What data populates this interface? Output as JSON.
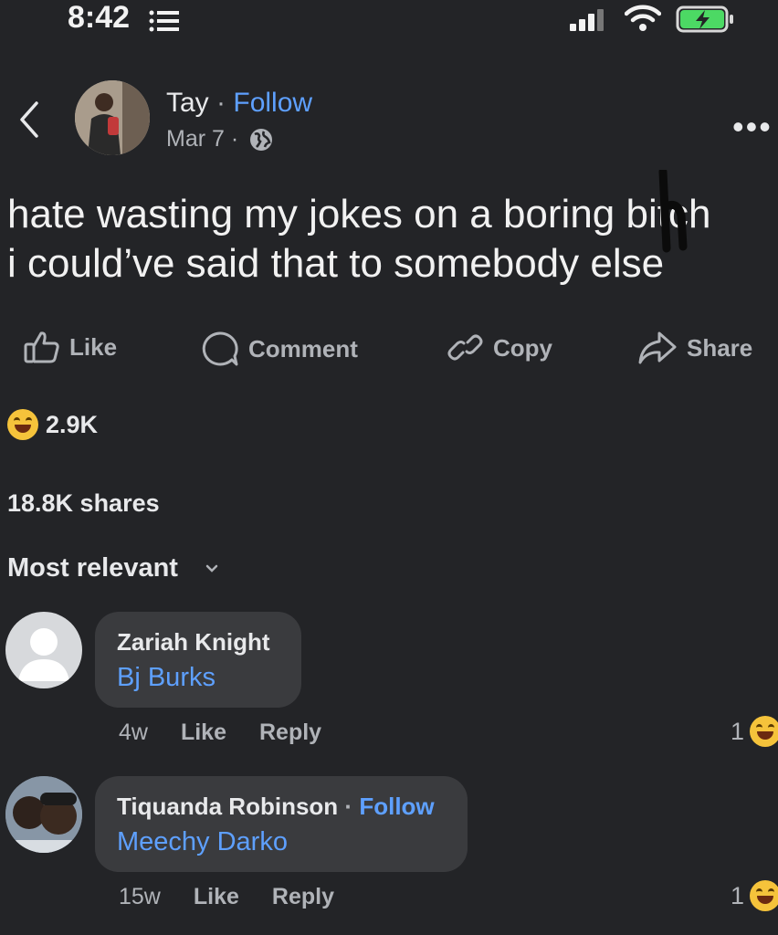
{
  "status_bar": {
    "time": "8:42"
  },
  "post": {
    "author": "Tay",
    "separator": "·",
    "follow_label": "Follow",
    "date": "Mar 7",
    "text_line1": "hate wasting my jokes on a boring bitch",
    "text_line2": "i could’ve said that to somebody else"
  },
  "actions": {
    "like": "Like",
    "comment": "Comment",
    "copy": "Copy",
    "share": "Share"
  },
  "stats": {
    "reactions": "2.9K",
    "shares": "18.8K shares"
  },
  "sort": {
    "label": "Most relevant"
  },
  "comments": [
    {
      "name": "Zariah Knight",
      "text": "Bj Burks",
      "age": "4w",
      "like": "Like",
      "reply": "Reply",
      "reaction_count": "1"
    },
    {
      "name": "Tiquanda Robinson",
      "follow_label": "Follow",
      "text": "Meechy Darko",
      "age": "15w",
      "like": "Like",
      "reply": "Reply",
      "reaction_count": "1"
    }
  ],
  "colors": {
    "background": "#232427",
    "link_blue": "#5ea0ff",
    "secondary_text": "#b0b3b8",
    "bubble": "#3a3b3e"
  }
}
